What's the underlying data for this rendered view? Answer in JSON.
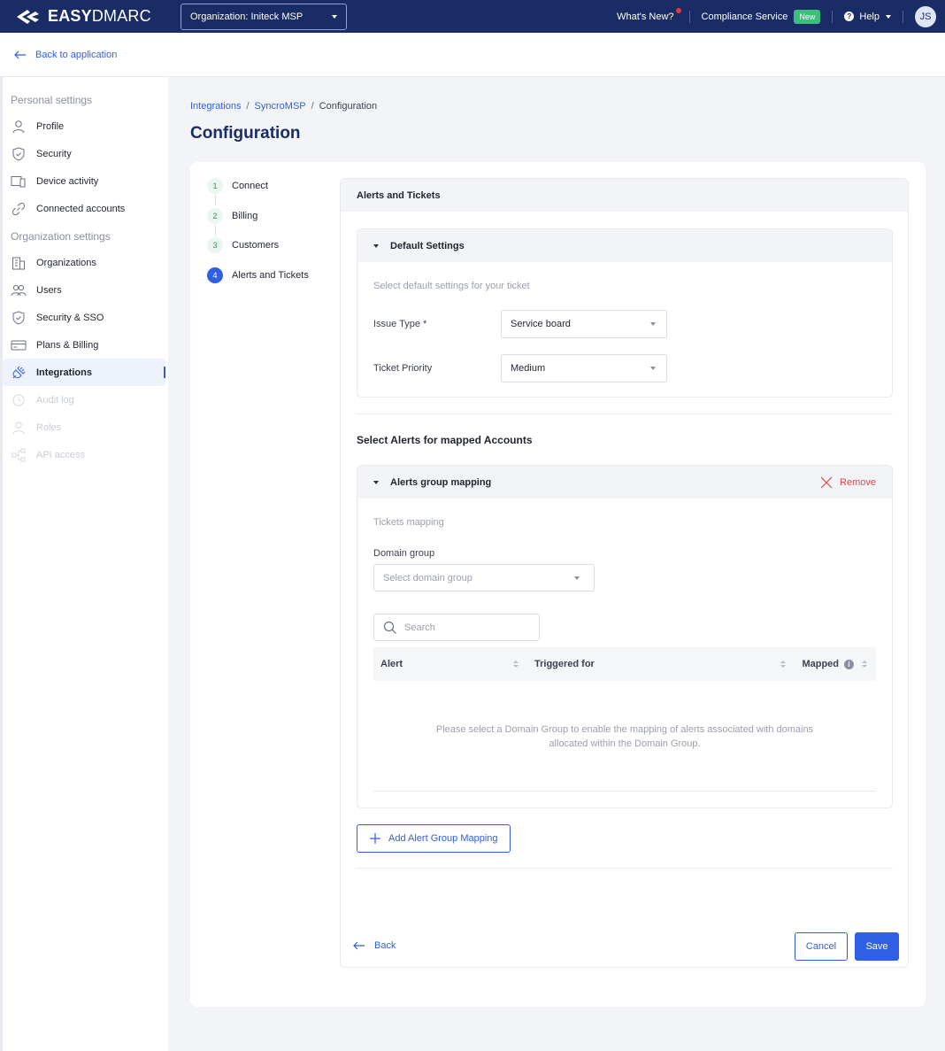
{
  "topbar": {
    "logo_bold": "EASY",
    "logo_light": "DMARC",
    "organization_select": "Organization: Initeck MSP",
    "whats_new": "What's New?",
    "compliance_service": "Compliance Service",
    "new_badge": "New",
    "help": "Help",
    "avatar_initials": "JS"
  },
  "subbar": {
    "back_label": "Back to application"
  },
  "sidebar": {
    "personal_heading": "Personal settings",
    "personal_items": [
      {
        "label": "Profile",
        "icon": "user-icon"
      },
      {
        "label": "Security",
        "icon": "shield-icon"
      },
      {
        "label": "Device activity",
        "icon": "devices-icon"
      },
      {
        "label": "Connected accounts",
        "icon": "link-icon"
      }
    ],
    "org_heading": "Organization settings",
    "org_items": [
      {
        "label": "Organizations",
        "icon": "building-icon"
      },
      {
        "label": "Users",
        "icon": "users-icon"
      },
      {
        "label": "Security & SSO",
        "icon": "shield-icon"
      },
      {
        "label": "Plans & Billing",
        "icon": "card-icon"
      },
      {
        "label": "Integrations",
        "icon": "plug-icon",
        "active": true
      },
      {
        "label": "Audit log",
        "icon": "history-icon",
        "disabled": true
      },
      {
        "label": "Roles",
        "icon": "user-icon",
        "disabled": true
      },
      {
        "label": "API access",
        "icon": "api-icon",
        "disabled": true
      }
    ]
  },
  "breadcrumb": [
    "Integrations",
    "SyncroMSP",
    "Configuration"
  ],
  "page_title": "Configuration",
  "steps": [
    {
      "num": "1",
      "label": "Connect"
    },
    {
      "num": "2",
      "label": "Billing"
    },
    {
      "num": "3",
      "label": "Customers"
    },
    {
      "num": "4",
      "label": "Alerts and Tickets",
      "current": true
    }
  ],
  "panel": {
    "title": "Alerts and Tickets",
    "default_settings": {
      "title": "Default Settings",
      "hint": "Select default settings for your ticket",
      "issue_type_label": "Issue Type *",
      "issue_type_value": "Service board",
      "ticket_priority_label": "Ticket Priority",
      "ticket_priority_value": "Medium"
    },
    "mapped_title": "Select Alerts for mapped Accounts",
    "group_mapping": {
      "title": "Alerts group mapping",
      "remove": "Remove",
      "tickets_mapping": "Tickets mapping",
      "domain_group_label": "Domain group",
      "domain_group_placeholder": "Select domain group",
      "search_placeholder": "Search",
      "columns": [
        "Alert",
        "Triggered for",
        "Mapped"
      ],
      "empty_line1": "Please select a Domain Group to enable the mapping of alerts associated with domains",
      "empty_line2": "allocated within the Domain Group."
    },
    "add_mapping": "Add Alert Group Mapping",
    "back": "Back",
    "cancel": "Cancel",
    "save": "Save"
  },
  "colors": {
    "topbar": "#1a2c66",
    "accent": "#2f5fe3",
    "remove": "#d94848",
    "new_badge": "#3cbf7d"
  }
}
